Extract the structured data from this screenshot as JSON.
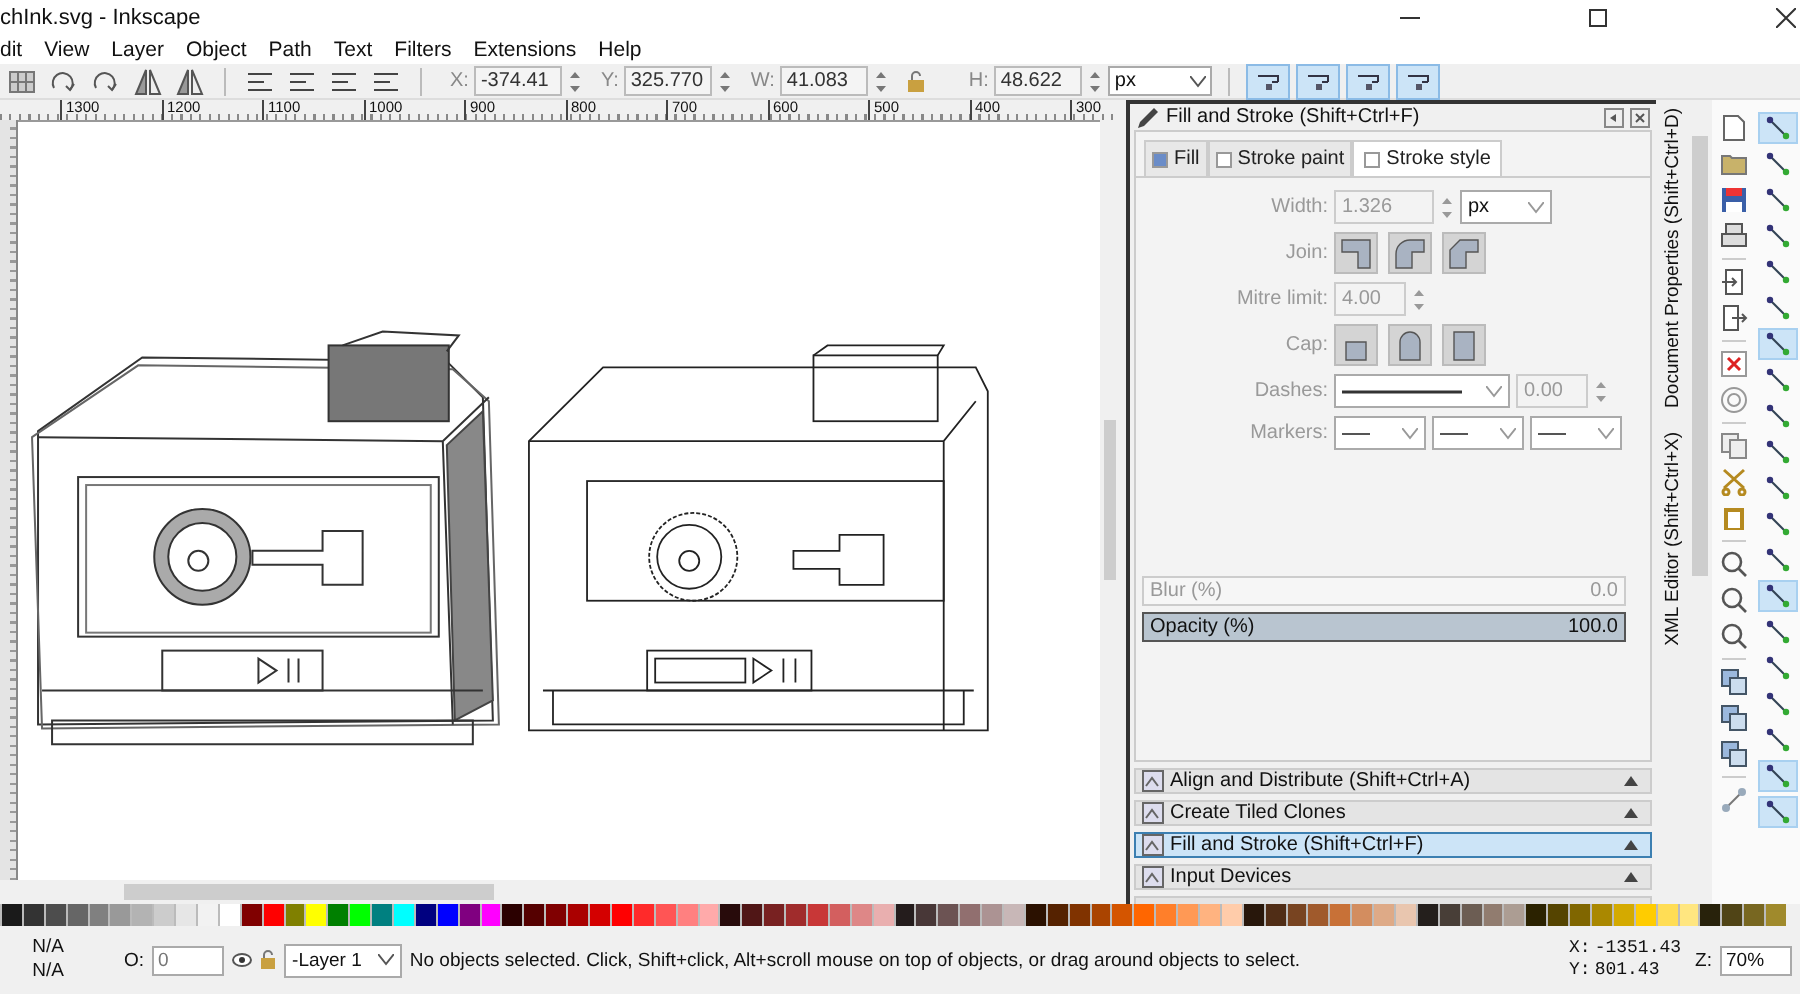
{
  "window": {
    "title": "chInk.svg - Inkscape"
  },
  "menu": [
    "dit",
    "View",
    "Layer",
    "Object",
    "Path",
    "Text",
    "Filters",
    "Extensions",
    "Help"
  ],
  "toolbar": {
    "fields": [
      {
        "label": "X:",
        "value": "-374.41"
      },
      {
        "label": "Y:",
        "value": "325.770"
      },
      {
        "label": "W:",
        "value": "41.083"
      },
      {
        "label": "H:",
        "value": "48.622"
      }
    ],
    "unit": "px",
    "toggles": [
      {
        "on": true
      },
      {
        "on": true
      },
      {
        "on": true
      },
      {
        "on": true
      }
    ]
  },
  "ruler": [
    "1300",
    "1200",
    "1100",
    "1000",
    "900",
    "800",
    "700",
    "600",
    "500",
    "400",
    "300"
  ],
  "dock": {
    "title": "Fill and Stroke (Shift+Ctrl+F)",
    "tabs": [
      {
        "label": "Fill",
        "selected": false
      },
      {
        "label": "Stroke paint",
        "selected": false
      },
      {
        "label": "Stroke style",
        "selected": true
      }
    ],
    "width": {
      "label": "Width:",
      "value": "1.326",
      "unit": "px",
      "disabled": true
    },
    "join": {
      "label": "Join:"
    },
    "mitre": {
      "label": "Mitre limit:",
      "value": "4.00",
      "disabled": true
    },
    "cap": {
      "label": "Cap:"
    },
    "dashes": {
      "label": "Dashes:",
      "value": "0.00",
      "disabled": true
    },
    "markers": {
      "label": "Markers:"
    },
    "blur": {
      "label": "Blur (%)",
      "value": "0.0",
      "disabled": true
    },
    "opacity": {
      "label": "Opacity (%)",
      "value": "100.0",
      "level": 1,
      "disabled": false
    },
    "panels": [
      {
        "title": "Align and Distribute (Shift+Ctrl+A)",
        "selected": false
      },
      {
        "title": "Create Tiled Clones",
        "selected": false
      },
      {
        "title": "Fill and Stroke (Shift+Ctrl+F)",
        "selected": true
      },
      {
        "title": "Input Devices",
        "selected": false
      }
    ]
  },
  "side_tabs": [
    "Document Properties (Shift+Ctrl+D)",
    "XML Editor (Shift+Ctrl+X)"
  ],
  "snap_toolbar": [
    {
      "on": true
    },
    {
      "on": false
    },
    {
      "on": false
    },
    {
      "on": false
    },
    {
      "on": false
    },
    {
      "on": false
    },
    {
      "on": true
    },
    {
      "on": false
    },
    {
      "on": false
    },
    {
      "on": false
    },
    {
      "on": false
    },
    {
      "on": false
    },
    {
      "on": false
    },
    {
      "on": true
    },
    {
      "on": false
    },
    {
      "on": false
    },
    {
      "on": false
    },
    {
      "on": false
    },
    {
      "on": true
    },
    {
      "on": true
    }
  ],
  "palette": [
    {
      "color": "#1a1a1a"
    },
    {
      "color": "#333333"
    },
    {
      "color": "#4d4d4d"
    },
    {
      "color": "#666666"
    },
    {
      "color": "#808080"
    },
    {
      "color": "#999999"
    },
    {
      "color": "#b3b3b3"
    },
    {
      "color": "#cccccc"
    },
    {
      "color": "#e6e6e6"
    },
    {
      "color": "#f2f2f2"
    },
    {
      "color": "#ffffff"
    },
    {
      "color": "#800000"
    },
    {
      "color": "#ff0000"
    },
    {
      "color": "#808000"
    },
    {
      "color": "#ffff00"
    },
    {
      "color": "#008000"
    },
    {
      "color": "#00ff00"
    },
    {
      "color": "#008080"
    },
    {
      "color": "#00ffff"
    },
    {
      "color": "#000080"
    },
    {
      "color": "#0000ff"
    },
    {
      "color": "#800080"
    },
    {
      "color": "#ff00ff"
    },
    {
      "color": "#2b0000"
    },
    {
      "color": "#550000"
    },
    {
      "color": "#800001"
    },
    {
      "color": "#aa0000"
    },
    {
      "color": "#d40000"
    },
    {
      "color": "#ff0001"
    },
    {
      "color": "#ff2a2a"
    },
    {
      "color": "#ff5555"
    },
    {
      "color": "#ff8080"
    },
    {
      "color": "#ffaaaa"
    },
    {
      "color": "#280b0b"
    },
    {
      "color": "#501616"
    },
    {
      "color": "#782121"
    },
    {
      "color": "#a02c2c"
    },
    {
      "color": "#c83737"
    },
    {
      "color": "#d35f5f"
    },
    {
      "color": "#de8787"
    },
    {
      "color": "#e9afaf"
    },
    {
      "color": "#241c1c"
    },
    {
      "color": "#483737"
    },
    {
      "color": "#6c5353"
    },
    {
      "color": "#916f6f"
    },
    {
      "color": "#ac9393"
    },
    {
      "color": "#c8b7b7"
    },
    {
      "color": "#2b1100"
    },
    {
      "color": "#552200"
    },
    {
      "color": "#803300"
    },
    {
      "color": "#aa4400"
    },
    {
      "color": "#d45500"
    },
    {
      "color": "#ff6600"
    },
    {
      "color": "#ff7f2a"
    },
    {
      "color": "#ff9955"
    },
    {
      "color": "#ffb380"
    },
    {
      "color": "#ffccaa"
    },
    {
      "color": "#28170b"
    },
    {
      "color": "#502d16"
    },
    {
      "color": "#784421"
    },
    {
      "color": "#a05a2c"
    },
    {
      "color": "#c87137"
    },
    {
      "color": "#d38d5f"
    },
    {
      "color": "#deaa87"
    },
    {
      "color": "#e9c6af"
    },
    {
      "color": "#241f1c"
    },
    {
      "color": "#483e37"
    },
    {
      "color": "#6c5d53"
    },
    {
      "color": "#917c6f"
    },
    {
      "color": "#ac9d93"
    },
    {
      "color": "#2b2200"
    },
    {
      "color": "#554400"
    },
    {
      "color": "#806600"
    },
    {
      "color": "#aa8800"
    },
    {
      "color": "#d4aa00"
    },
    {
      "color": "#ffcc00"
    },
    {
      "color": "#ffdd55"
    },
    {
      "color": "#ffe680"
    },
    {
      "color": "#28220b"
    },
    {
      "color": "#504416"
    },
    {
      "color": "#786721"
    },
    {
      "color": "#a08a2c"
    }
  ],
  "status": {
    "fill": "N/A",
    "stroke": "N/A",
    "opacity_label": "O:",
    "opacity_value": "0",
    "layer": "-Layer 1",
    "message": "No objects selected. Click, Shift+click, Alt+scroll mouse on top of objects, or drag around objects to select.",
    "cursor": [
      {
        "label": "X:",
        "value": "-1351.43"
      },
      {
        "label": "Y:",
        "value": "801.43"
      }
    ],
    "zoom_label": "Z:",
    "zoom": "70%"
  }
}
